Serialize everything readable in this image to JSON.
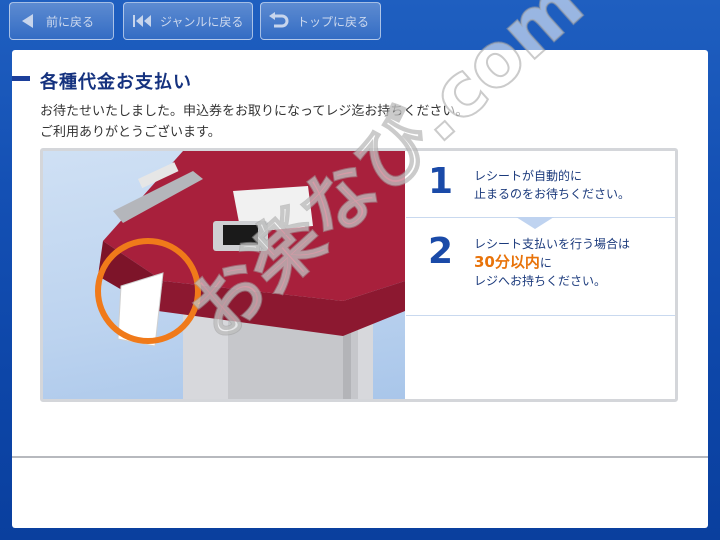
{
  "nav": {
    "back_label": "前に戻る",
    "genre_label": "ジャンルに戻る",
    "top_label": "トップに戻る"
  },
  "page": {
    "title": "各種代金お支払い",
    "message_line1": "お待たせいたしました。申込券をお取りになってレジ迄お持ちください。",
    "message_line2": "ご利用ありがとうございます。"
  },
  "steps": [
    {
      "number": "1",
      "line1": "レシートが自動的に",
      "line2": "止まるのをお待ちください。"
    },
    {
      "number": "2",
      "line1": "レシート支払いを行う場合は",
      "highlight": "30分以内",
      "highlight_suffix": "に",
      "line3": "レジへお持ちください。"
    }
  ],
  "watermark": "お楽なび.com",
  "colors": {
    "background": "#1450b4",
    "title": "#15327f",
    "step_number": "#1a4aa8",
    "highlight": "#e8730a",
    "machine": "#a8203c",
    "ring": "#f07a1a"
  }
}
